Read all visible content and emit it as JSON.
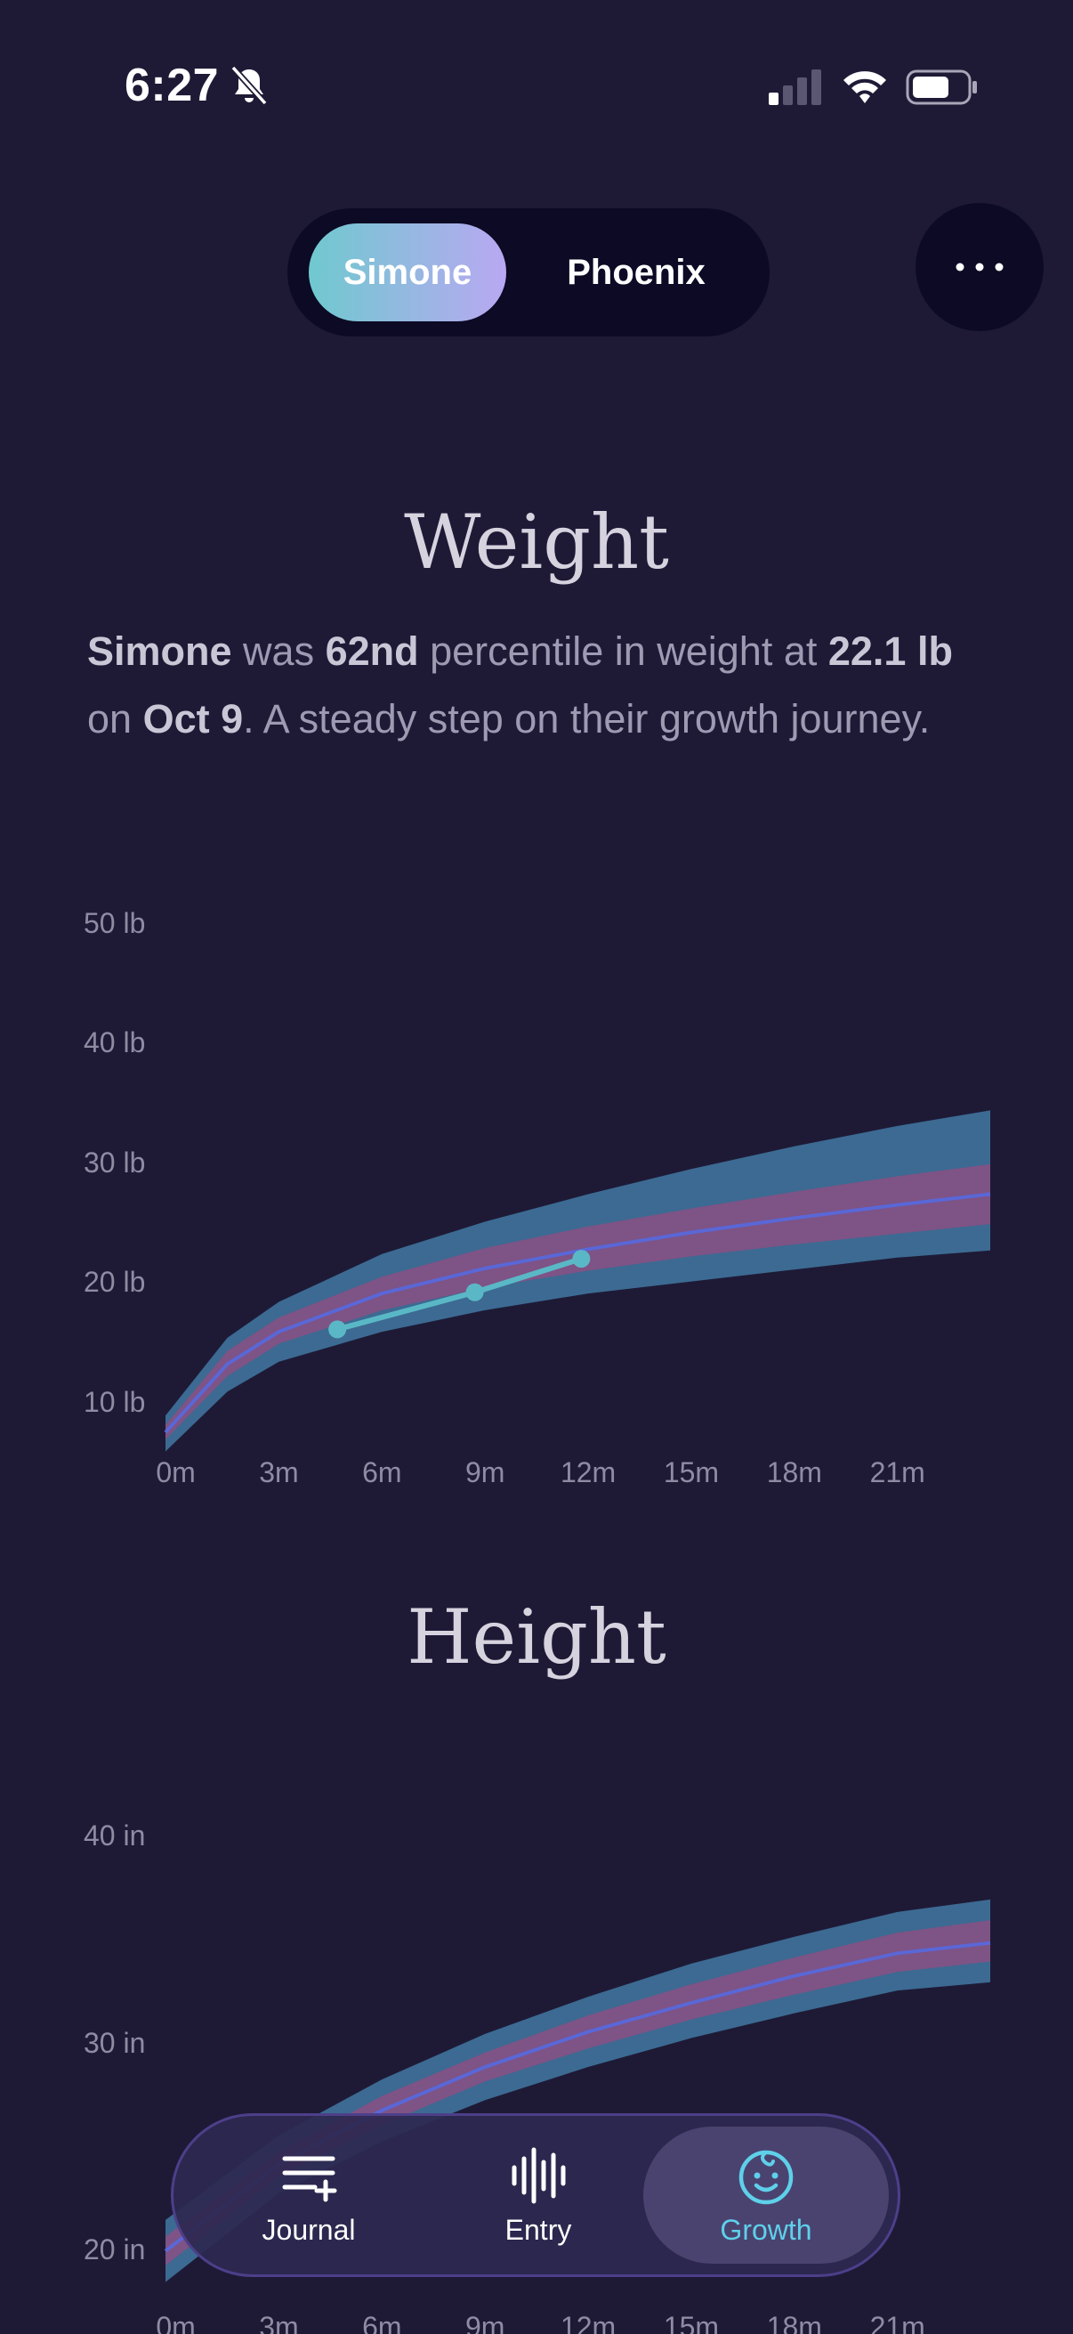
{
  "status_bar": {
    "time": "6:27",
    "icons": [
      "bell-slash-icon",
      "cellular-signal-icon",
      "wifi-icon",
      "battery-icon"
    ]
  },
  "profile_switch": {
    "options": [
      "Simone",
      "Phoenix"
    ],
    "selected": "Simone"
  },
  "more_button": {
    "icon": "ellipsis-icon"
  },
  "weight_section": {
    "title": "Weight",
    "summary": {
      "name": "Simone",
      "t1": " was ",
      "percentile": "62nd",
      "t2": " percentile in weight at ",
      "value": "22.1 lb",
      "t3": " on ",
      "date": "Oct 9",
      "t4": ". A steady step on their growth journey."
    }
  },
  "height_section": {
    "title": "Height"
  },
  "chart_data": [
    {
      "type": "line",
      "title": "Weight",
      "y_ticks": [
        "10 lb",
        "20 lb",
        "30 lb",
        "40 lb",
        "50 lb"
      ],
      "x_ticks": [
        "0m",
        "3m",
        "6m",
        "9m",
        "12m",
        "15m",
        "18m",
        "21m"
      ],
      "ylim": [
        5,
        50
      ],
      "xlim": [
        -0.3,
        23.7
      ],
      "grid": false,
      "bands": {
        "x": [
          -0.3,
          1.5,
          3,
          6,
          9,
          12,
          15,
          18,
          21,
          23.7
        ],
        "outer_low": [
          6.0,
          11.0,
          13.5,
          16.0,
          17.8,
          19.2,
          20.2,
          21.2,
          22.2,
          22.8
        ],
        "outer_high": [
          9.0,
          15.5,
          18.5,
          22.5,
          25.2,
          27.5,
          29.6,
          31.5,
          33.2,
          34.5
        ],
        "inner_low": [
          7.0,
          12.3,
          15.0,
          17.8,
          19.7,
          21.1,
          22.3,
          23.3,
          24.2,
          25.0
        ],
        "inner_high": [
          8.2,
          14.4,
          17.2,
          20.6,
          23.0,
          24.8,
          26.3,
          27.7,
          29.0,
          30.0
        ],
        "median": [
          7.6,
          13.3,
          16.0,
          19.2,
          21.3,
          22.9,
          24.3,
          25.5,
          26.6,
          27.5
        ]
      },
      "series": [
        {
          "name": "Simone",
          "x": [
            4.7,
            8.7,
            11.8
          ],
          "values": [
            16.2,
            19.3,
            22.1
          ]
        }
      ]
    },
    {
      "type": "line",
      "title": "Height",
      "y_ticks": [
        "20 in",
        "30 in",
        "40 in"
      ],
      "x_ticks": [
        "0m",
        "3m",
        "6m",
        "9m",
        "12m",
        "15m",
        "18m",
        "21m"
      ],
      "ylim": [
        19,
        41
      ],
      "xlim": [
        -0.3,
        23.7
      ],
      "grid": false,
      "bands": {
        "x": [
          -0.3,
          3,
          6,
          9,
          12,
          15,
          18,
          21,
          23.7
        ],
        "outer_low": [
          18.5,
          22.8,
          25.3,
          27.3,
          28.9,
          30.3,
          31.5,
          32.6,
          33.0
        ],
        "outer_high": [
          21.5,
          25.6,
          28.3,
          30.5,
          32.3,
          33.9,
          35.2,
          36.4,
          37.0
        ],
        "inner_low": [
          19.3,
          23.6,
          26.1,
          28.2,
          29.8,
          31.2,
          32.4,
          33.5,
          34.0
        ],
        "inner_high": [
          20.7,
          24.8,
          27.5,
          29.6,
          31.4,
          32.9,
          34.2,
          35.4,
          36.0
        ],
        "median": [
          20.0,
          24.2,
          26.8,
          28.9,
          30.6,
          32.0,
          33.3,
          34.4,
          34.9
        ]
      },
      "series": []
    }
  ],
  "bottom_nav": {
    "items": [
      {
        "label": "Journal",
        "icon": "journal-add-icon",
        "active": false
      },
      {
        "label": "Entry",
        "icon": "waveform-icon",
        "active": false
      },
      {
        "label": "Growth",
        "icon": "baby-face-icon",
        "active": true
      }
    ]
  },
  "colors": {
    "background": "#1e1a36",
    "outer_band": "#3f739c",
    "inner_band": "#8a4f83",
    "median_line": "#5a67d6",
    "data_line": "#5ab8c6",
    "active_nav": "#5fd0ea"
  }
}
